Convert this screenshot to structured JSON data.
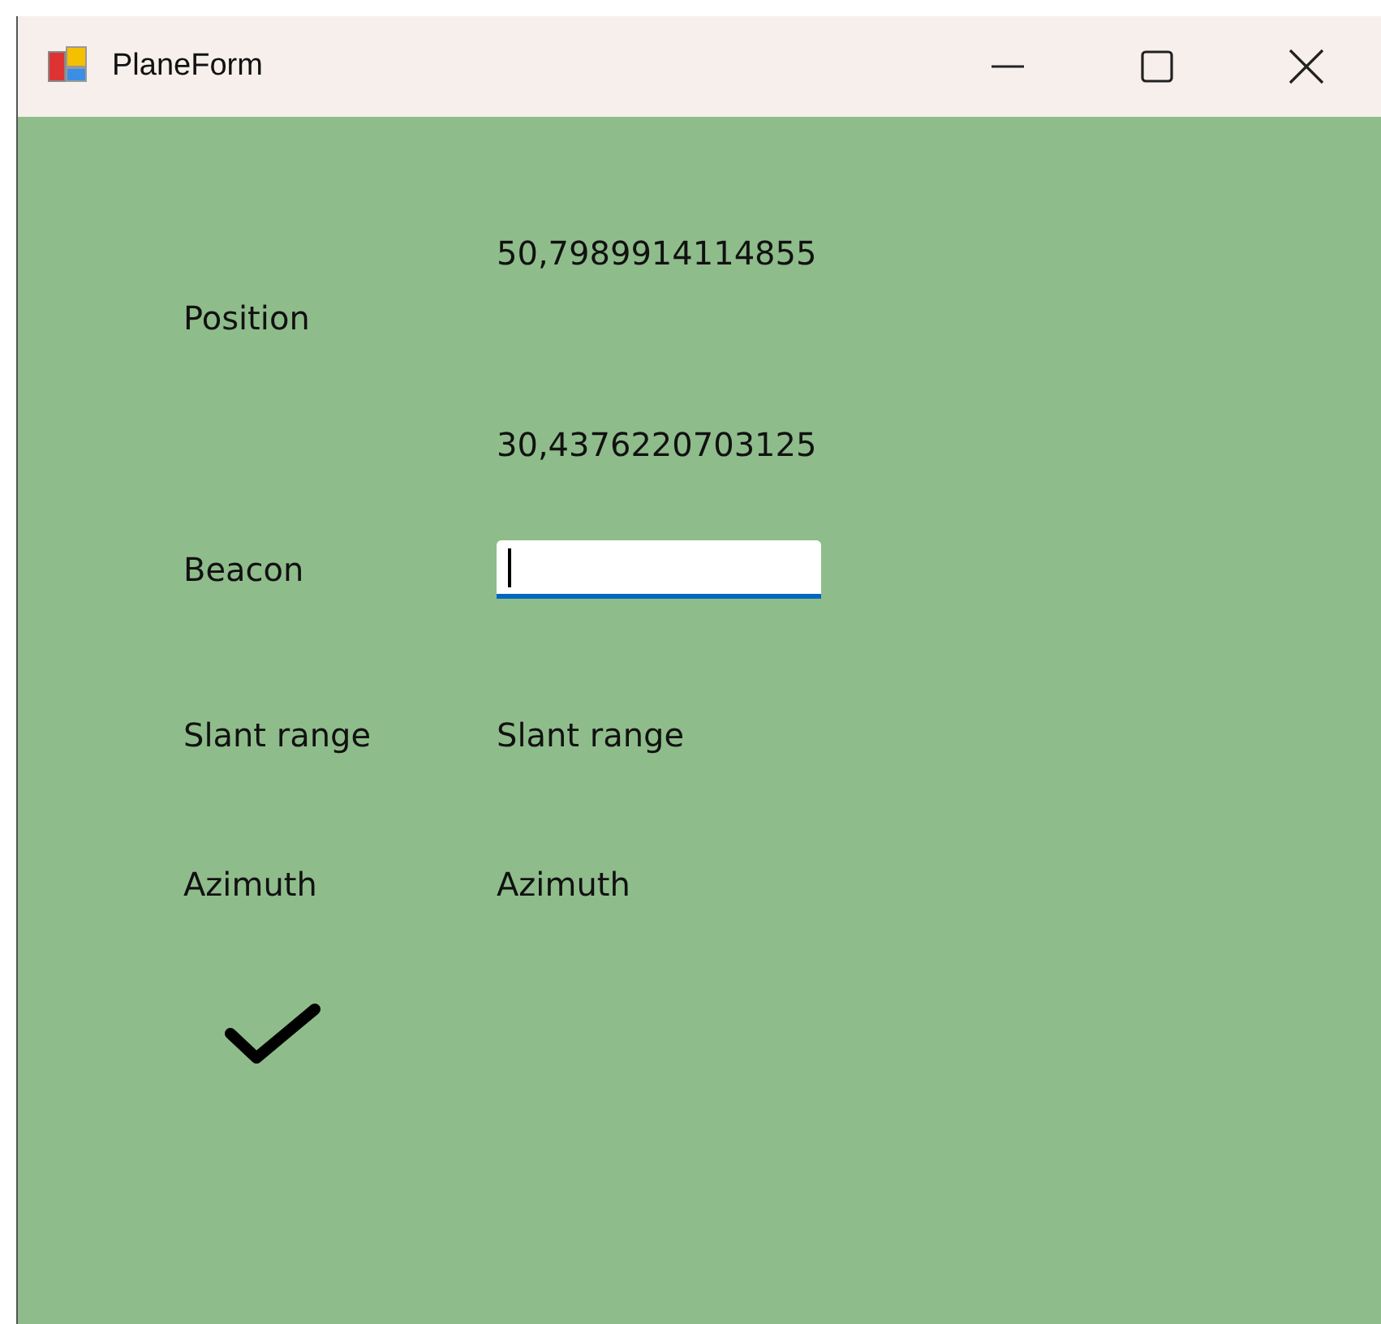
{
  "window": {
    "title": "PlaneForm"
  },
  "position": {
    "label": "Position",
    "latitude": "50,7989914114855",
    "longitude": "30,4376220703125"
  },
  "beacon": {
    "label": "Beacon",
    "focused": true
  },
  "slant_range": {
    "label": "Slant range",
    "value": "Slant range"
  },
  "azimuth": {
    "label": "Azimuth",
    "value": "Azimuth"
  }
}
